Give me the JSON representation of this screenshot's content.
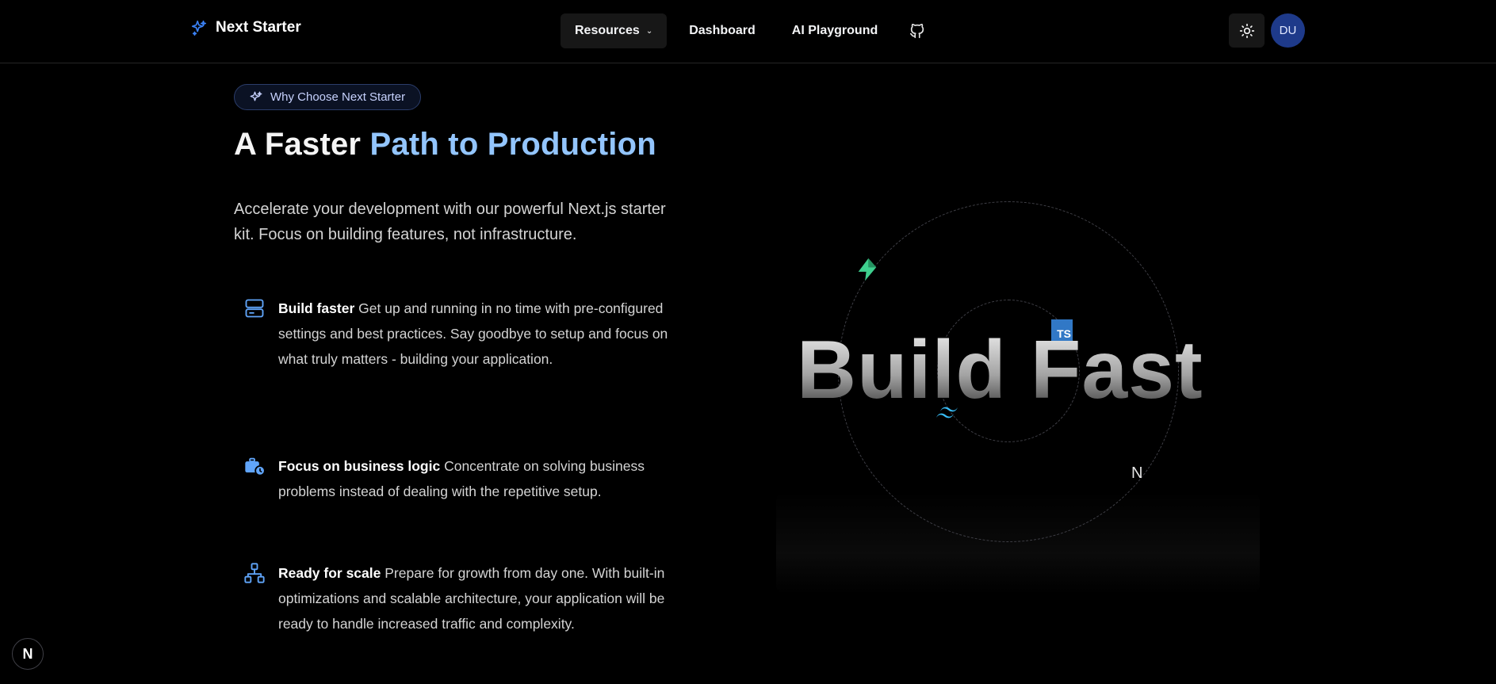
{
  "header": {
    "brand": "Next Starter",
    "nav": [
      {
        "label": "Resources"
      },
      {
        "label": "Dashboard"
      },
      {
        "label": "AI Playground"
      }
    ],
    "avatar_initials": "DU"
  },
  "hero": {
    "badge": "Why Choose Next Starter",
    "title_plain": "A Faster ",
    "title_highlight": "Path to Production",
    "subtitle": "Accelerate your development with our powerful Next.js starter kit. Focus on building features, not infrastructure."
  },
  "features": [
    {
      "title": "Build faster",
      "text": "Get up and running in no time with pre-configured settings and best practices. Say goodbye to setup and focus on what truly matters - building your application.",
      "icon": "server-icon"
    },
    {
      "title": "Focus on business logic",
      "text": "Concentrate on solving business problems instead of dealing with the repetitive setup.",
      "icon": "briefcase-clock-icon"
    },
    {
      "title": "Ready for scale",
      "text": "Prepare for growth from day one. With built-in optimizations and scalable architecture, your application will be ready to handle increased traffic and complexity.",
      "icon": "network-icon"
    }
  ],
  "visual": {
    "headline": "Build Fast",
    "ts_label": "TS",
    "next_glyph": "N"
  },
  "colors": {
    "accent": "#93c5fd",
    "avatar_bg": "#1e3a8a",
    "supabase": "#3ecf8e",
    "typescript": "#3178c6",
    "tailwind": "#38bdf8"
  },
  "dev_indicator": "N"
}
